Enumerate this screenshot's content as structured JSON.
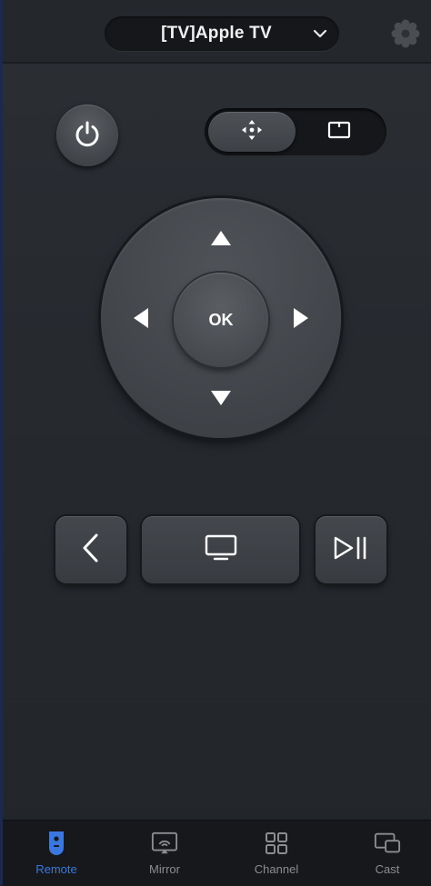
{
  "header": {
    "device_name": "[TV]Apple TV",
    "chevron_icon": "chevron-down-icon",
    "settings_icon": "gear-icon"
  },
  "controls": {
    "power_icon": "power-icon",
    "mode_toggle": {
      "active": "touchpad",
      "options": [
        "move-arrows-icon",
        "screen-icon"
      ]
    },
    "dpad": {
      "ok_label": "OK",
      "up_icon": "arrow-up-icon",
      "down_icon": "arrow-down-icon",
      "left_icon": "arrow-left-icon",
      "right_icon": "arrow-right-icon"
    },
    "back_icon": "back-chevron-icon",
    "home_icon": "tv-icon",
    "play_pause_icon": "play-pause-icon"
  },
  "tabbar": {
    "tabs": [
      {
        "label": "Remote",
        "icon": "remote-icon",
        "active": true
      },
      {
        "label": "Mirror",
        "icon": "mirror-icon",
        "active": false
      },
      {
        "label": "Channel",
        "icon": "grid-icon",
        "active": false
      },
      {
        "label": "Cast",
        "icon": "cast-icon",
        "active": false
      }
    ]
  },
  "colors": {
    "accent": "#3a78e0",
    "background": "#262a2f",
    "inactive_text": "#8a8d91"
  }
}
